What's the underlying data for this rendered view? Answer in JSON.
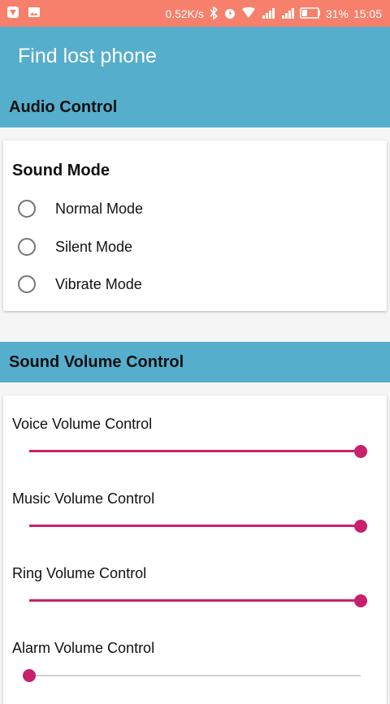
{
  "status_bar": {
    "net_speed": "0.52K/s",
    "battery": "31%",
    "time": "15:05"
  },
  "app_bar": {
    "title": "Find lost phone"
  },
  "audio_section": {
    "header": "Audio Control",
    "card_title": "Sound Mode",
    "options": [
      {
        "label": "Normal Mode",
        "selected": false
      },
      {
        "label": "Silent Mode",
        "selected": false
      },
      {
        "label": "Vibrate Mode",
        "selected": false
      }
    ]
  },
  "volume_section": {
    "header": "Sound Volume Control",
    "controls": [
      {
        "label": "Voice Volume Control",
        "level": 1.0
      },
      {
        "label": "Music Volume Control",
        "level": 1.0
      },
      {
        "label": "Ring Volume Control",
        "level": 1.0
      },
      {
        "label": "Alarm Volume Control",
        "level": 0.0
      }
    ]
  },
  "colors": {
    "status_bar": "#f6806b",
    "primary": "#56aecd",
    "accent": "#c9206b"
  }
}
